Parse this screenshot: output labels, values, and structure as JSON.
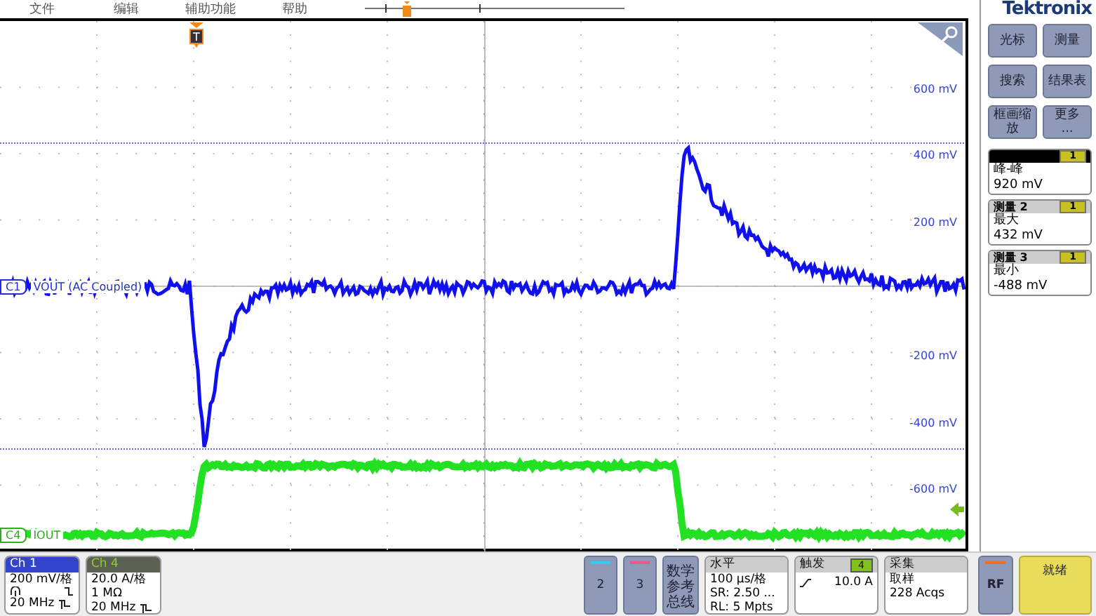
{
  "menu": [
    {
      "label": "文件"
    },
    {
      "label": "编辑"
    },
    {
      "label": "辅助功能"
    },
    {
      "label": "帮助"
    }
  ],
  "brand": "Tektronix",
  "plot": {
    "axis_labels": [
      "600 mV",
      "400 mV",
      "200 mV",
      "-200 mV",
      "-400 mV",
      "-600 mV"
    ],
    "channels": [
      {
        "badge": "C1",
        "label": "VOUT (AC Coupled)",
        "color": "#1010ee"
      },
      {
        "badge": "C4",
        "label": "IOUT",
        "color": "#22e022"
      }
    ],
    "trigger_marker": "T"
  },
  "side_buttons": [
    {
      "label": "光标"
    },
    {
      "label": "测量"
    },
    {
      "label": "搜索"
    },
    {
      "label": "结果表"
    },
    {
      "label": "框画缩放"
    },
    {
      "label": "更多 ..."
    }
  ],
  "measurements": [
    {
      "badge": "1",
      "name": "峰-峰",
      "value": "920 mV"
    },
    {
      "title": "测量 2",
      "badge": "1",
      "name": "最大",
      "value": "432 mV"
    },
    {
      "title": "测量 3",
      "badge": "1",
      "name": "最小",
      "value": "-488 mV"
    }
  ],
  "channel_cards": [
    {
      "title": "Ch 1",
      "selected": true,
      "coupling_icons": true,
      "lines": [
        "200 mV/格",
        "20 MHz"
      ]
    },
    {
      "title": "Ch 4",
      "selected": false,
      "coupling_icons": false,
      "lines": [
        "20.0 A/格",
        "1 MΩ",
        "20 MHz"
      ]
    }
  ],
  "inactive_channels": [
    {
      "label": "2",
      "color": "#33ccee"
    },
    {
      "label": "3",
      "color": "#ee5588"
    }
  ],
  "math_button": "数学参考总线",
  "horizontal": {
    "title": "水平",
    "lines": [
      "100 µs/格",
      "SR: 2.50 ...",
      "RL: 5 Mpts"
    ]
  },
  "trigger": {
    "title": "触发",
    "badge": "4",
    "value": "10.0 A"
  },
  "acquisition": {
    "title": "采集",
    "lines": [
      "取样",
      "228 Acqs"
    ]
  },
  "rf_button": "RF",
  "status_button": "就绪"
}
